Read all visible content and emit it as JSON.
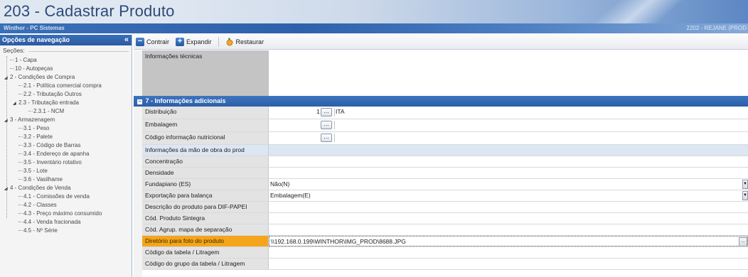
{
  "window": {
    "title": "203 - Cadastrar  Produto",
    "subtitle": "Winthor - PC Sistemas",
    "user": "2202 - REJANE (PROD"
  },
  "nav": {
    "header": "Opções de navegação",
    "collapse_glyph": "«",
    "sections_label": "Seções:",
    "items": [
      {
        "label": "1 - Capa",
        "level": 1,
        "toggle": ""
      },
      {
        "label": "10 - Autopeças",
        "level": 1,
        "toggle": ""
      },
      {
        "label": "2 - Condições de Compra",
        "level": 1,
        "toggle": "◢"
      },
      {
        "label": "2.1 - Política comercial compra",
        "level": 2,
        "toggle": ""
      },
      {
        "label": "2.2 - Tributação Outros",
        "level": 2,
        "toggle": ""
      },
      {
        "label": "2.3 - Tributação entrada",
        "level": 2,
        "toggle": "◢"
      },
      {
        "label": "2.3.1 - NCM",
        "level": 3,
        "toggle": ""
      },
      {
        "label": "3 - Armazenagem",
        "level": 1,
        "toggle": "◢"
      },
      {
        "label": "3.1 - Peso",
        "level": 2,
        "toggle": ""
      },
      {
        "label": "3.2 - Palete",
        "level": 2,
        "toggle": ""
      },
      {
        "label": "3.3 - Código de Barras",
        "level": 2,
        "toggle": ""
      },
      {
        "label": "3.4 - Endereço de apanha",
        "level": 2,
        "toggle": ""
      },
      {
        "label": "3.5 - Inventário rotativo",
        "level": 2,
        "toggle": ""
      },
      {
        "label": "3.5 - Lote",
        "level": 2,
        "toggle": ""
      },
      {
        "label": "3.6 - Vasilhame",
        "level": 2,
        "toggle": ""
      },
      {
        "label": "4 - Condições de Venda",
        "level": 1,
        "toggle": "◢"
      },
      {
        "label": "4.1 - Comissões de venda",
        "level": 2,
        "toggle": ""
      },
      {
        "label": "4.2 - Classes",
        "level": 2,
        "toggle": ""
      },
      {
        "label": "4.3 - Preço máximo consumido",
        "level": 2,
        "toggle": ""
      },
      {
        "label": "4.4 - Venda fracionada",
        "level": 2,
        "toggle": ""
      },
      {
        "label": "4.5 - Nº Série",
        "level": 2,
        "toggle": ""
      }
    ]
  },
  "toolbar": {
    "collapse_label": "Contrair",
    "expand_label": "Expandir",
    "restore_label": "Restaurar"
  },
  "grid": {
    "info_label": "Informações técnicas",
    "category": "7 - Informações adicionais",
    "rows": [
      {
        "label": "Distribuição",
        "value": "ITA",
        "number": "1",
        "kind": "lookup"
      },
      {
        "label": "Embalagem",
        "value": "",
        "number": "",
        "kind": "lookup"
      },
      {
        "label": "Código informação nutricional",
        "value": "",
        "number": "",
        "kind": "lookup"
      },
      {
        "label": "Informações da mão de obra do prod",
        "value": "",
        "number": "",
        "kind": "band"
      },
      {
        "label": "Concentração",
        "value": "",
        "number": "",
        "kind": "text"
      },
      {
        "label": "Densidade",
        "value": "",
        "number": "",
        "kind": "text"
      },
      {
        "label": "Fundapiano (ES)",
        "value": "Não(N)",
        "number": "",
        "kind": "dropdown"
      },
      {
        "label": "Exportação para balança",
        "value": "Embalagem(E)",
        "number": "",
        "kind": "dropdown"
      },
      {
        "label": "Descrição do produto para DIF-PAPEI",
        "value": "",
        "number": "",
        "kind": "text"
      },
      {
        "label": "Cód. Produto Sintegra",
        "value": "",
        "number": "",
        "kind": "text"
      },
      {
        "label": "Cód. Agrup. mapa de separação",
        "value": "",
        "number": "",
        "kind": "text"
      },
      {
        "label": "Diretório para foto do produto",
        "value": "\\\\192.168.0.199\\WINTHOR\\IMG_PROD\\8688.JPG",
        "number": "",
        "kind": "highlight"
      },
      {
        "label": "Código da tabela / Litragem",
        "value": "",
        "number": "",
        "kind": "text"
      },
      {
        "label": "Código do grupo da tabela / Litragem",
        "value": "",
        "number": "",
        "kind": "text"
      }
    ]
  },
  "colors": {
    "accent": "#2b5fa8",
    "highlight": "#f4a51b",
    "label_bg": "#e3e3e3"
  }
}
